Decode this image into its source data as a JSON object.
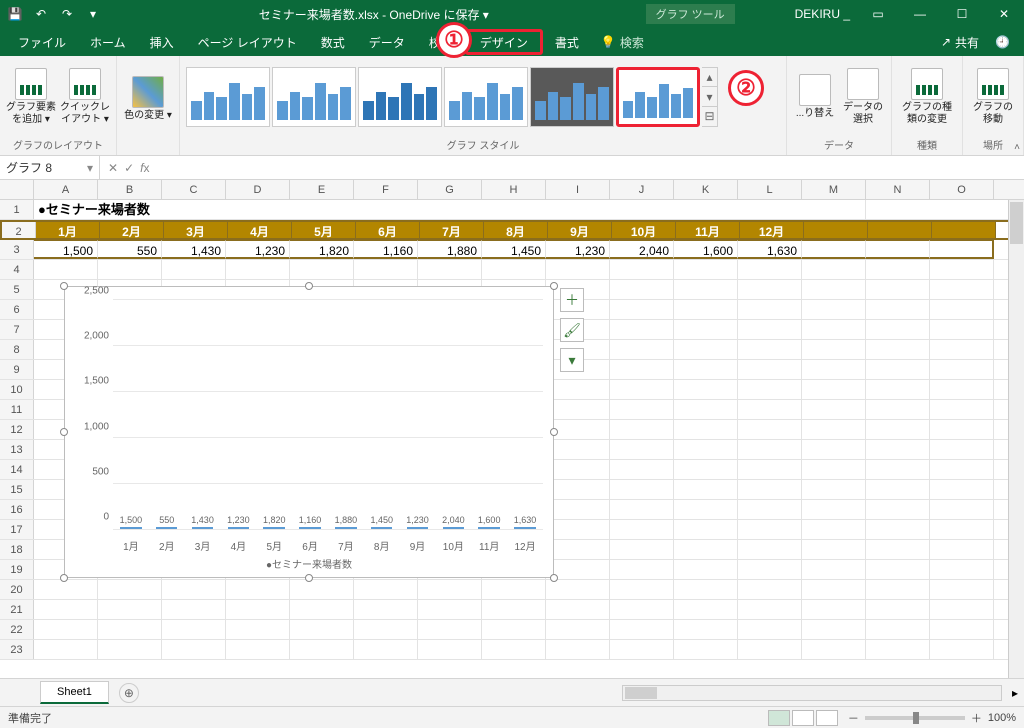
{
  "titlebar": {
    "filename": "セミナー来場者数.xlsx - OneDrive に保存 ▾",
    "tool_context": "グラフ ツール",
    "user": "DEKIRU _"
  },
  "tabs": {
    "file": "ファイル",
    "home": "ホーム",
    "insert": "挿入",
    "pagelayout": "ページ レイアウト",
    "formulas": "数式",
    "data": "データ",
    "review": "校閲",
    "design": "デザイン",
    "format": "書式",
    "search": "検索",
    "share": "共有"
  },
  "ribbon": {
    "group_layout": "グラフのレイアウト",
    "btn_add_element": "グラフ要素を追加 ▾",
    "btn_quick_layout": "クイックレイアウト ▾",
    "btn_change_colors": "色の変更 ▾",
    "group_styles": "グラフ スタイル",
    "btn_switch": "...り替え",
    "btn_select_data": "データの選択",
    "group_data": "データ",
    "btn_change_type": "グラフの種類の変更",
    "group_type": "種類",
    "btn_move_chart": "グラフの移動",
    "group_location": "場所"
  },
  "namebox": "グラフ 8",
  "columns": [
    "A",
    "B",
    "C",
    "D",
    "E",
    "F",
    "G",
    "H",
    "I",
    "J",
    "K",
    "L",
    "M",
    "N",
    "O"
  ],
  "table": {
    "title": "●セミナー来場者数",
    "months": [
      "1月",
      "2月",
      "3月",
      "4月",
      "5月",
      "6月",
      "7月",
      "8月",
      "9月",
      "10月",
      "11月",
      "12月"
    ],
    "values": [
      "1,500",
      "550",
      "1,430",
      "1,230",
      "1,820",
      "1,160",
      "1,880",
      "1,450",
      "1,230",
      "2,040",
      "1,600",
      "1,630"
    ]
  },
  "chart_data": {
    "type": "bar",
    "categories": [
      "1月",
      "2月",
      "3月",
      "4月",
      "5月",
      "6月",
      "7月",
      "8月",
      "9月",
      "10月",
      "11月",
      "12月"
    ],
    "values": [
      1500,
      550,
      1430,
      1230,
      1820,
      1160,
      1880,
      1450,
      1230,
      2040,
      1600,
      1630
    ],
    "data_labels": [
      "1,500",
      "550",
      "1,430",
      "1,230",
      "1,820",
      "1,160",
      "1,880",
      "1,450",
      "1,230",
      "2,040",
      "1,600",
      "1,630"
    ],
    "title": "",
    "legend": "●セミナー来場者数",
    "xlabel": "",
    "ylabel": "",
    "ylim": [
      0,
      2500
    ],
    "yticks": [
      0,
      500,
      1000,
      1500,
      2000,
      2500
    ]
  },
  "sheet_tab": "Sheet1",
  "status": "準備完了",
  "zoom": "100%",
  "callouts": {
    "one": "①",
    "two": "②"
  }
}
